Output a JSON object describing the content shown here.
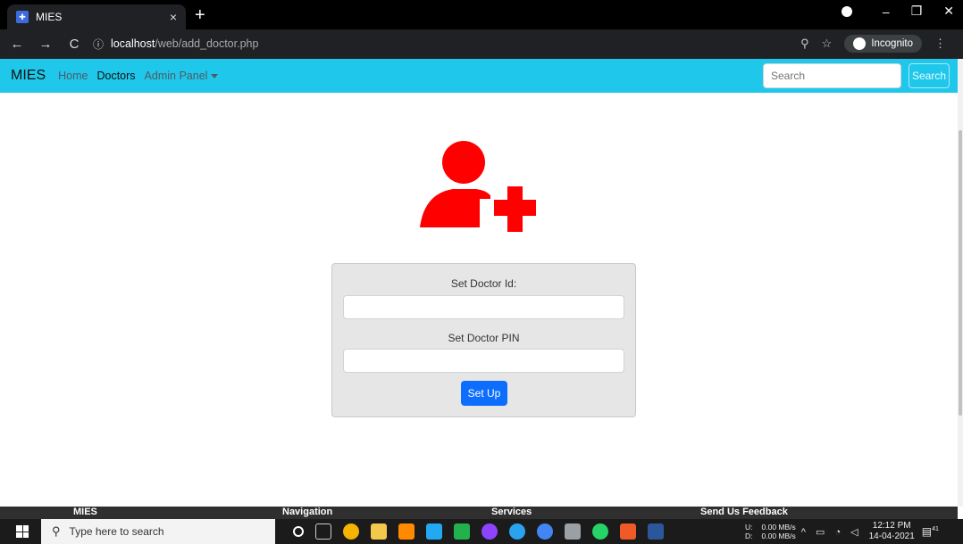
{
  "browser": {
    "tab_title": "MIES",
    "tab_close": "×",
    "new_tab": "+",
    "url_host": "localhost",
    "url_path": "/web/add_doctor.php",
    "incognito_label": "Incognito"
  },
  "navbar": {
    "brand": "MIES",
    "links": [
      "Home",
      "Doctors",
      "Admin Panel"
    ],
    "search_placeholder": "Search",
    "search_button": "Search"
  },
  "form": {
    "doctor_id_label": "Set Doctor Id:",
    "doctor_pin_label": "Set Doctor PIN",
    "submit_label": "Set Up"
  },
  "footer": {
    "columns": [
      "MIES",
      "Navigation",
      "Services",
      "Send Us Feedback"
    ]
  },
  "taskbar": {
    "search_placeholder": "Type here to search",
    "net_labels": [
      "U:",
      "D:"
    ],
    "net_speeds": [
      "0.00 MB/s",
      "0.00 MB/s"
    ],
    "time": "12:12 PM",
    "date": "14-04-2021",
    "notification_count": "41"
  },
  "colors": {
    "navbar": "#1fc7ea",
    "hero_icon": "#ff0000",
    "primary_button": "#0d6efd"
  }
}
